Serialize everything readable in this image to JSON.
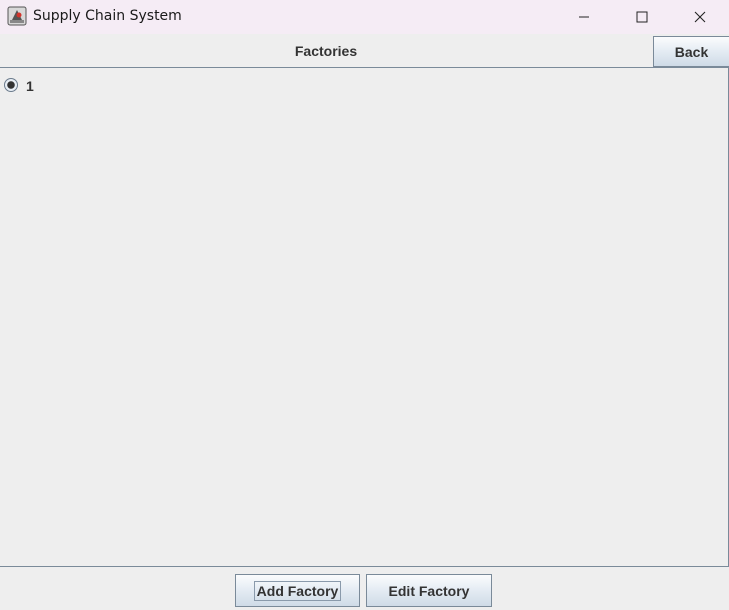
{
  "window": {
    "title": "Supply Chain System",
    "app_icon": "java-app-icon",
    "controls": [
      "minimize-icon",
      "maximize-icon",
      "close-icon"
    ]
  },
  "header": {
    "title": "Factories",
    "back_label": "Back"
  },
  "list": {
    "items": [
      {
        "label": "1",
        "selected": true
      }
    ]
  },
  "footer": {
    "add_label": "Add Factory",
    "edit_label": "Edit Factory"
  },
  "colors": {
    "titlebar_bg": "#f5ecf5",
    "panel_bg": "#eeeeee",
    "border": "#7a8a99",
    "text": "#333333"
  }
}
